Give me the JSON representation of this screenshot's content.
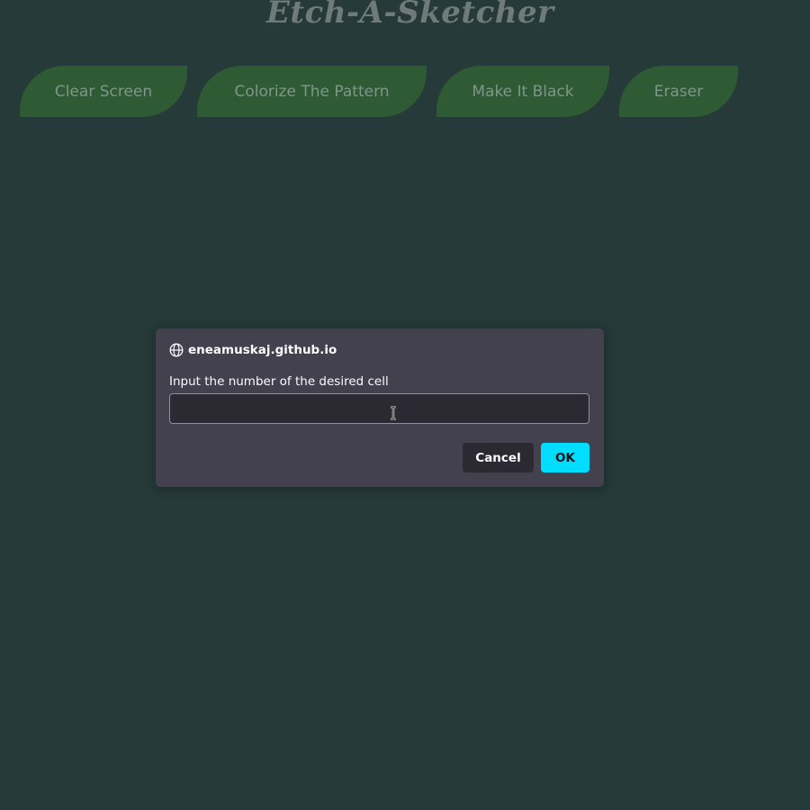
{
  "app": {
    "title": "Etch-A-Sketcher"
  },
  "toolbar": {
    "buttons": [
      {
        "label": "Clear Screen"
      },
      {
        "label": "Colorize The Pattern"
      },
      {
        "label": "Make It Black"
      },
      {
        "label": "Eraser"
      }
    ]
  },
  "dialog": {
    "origin": "eneamuskaj.github.io",
    "origin_icon": "globe-icon",
    "message": "Input the number of the desired cell",
    "input_value": "",
    "cancel_label": "Cancel",
    "ok_label": "OK"
  },
  "colors": {
    "background": "#263a3a",
    "button_bg": "#2e5a34",
    "button_text": "#7f968c",
    "title_text": "#6f7b78",
    "dialog_bg": "#42414d",
    "ok_accent": "#00ddff"
  }
}
